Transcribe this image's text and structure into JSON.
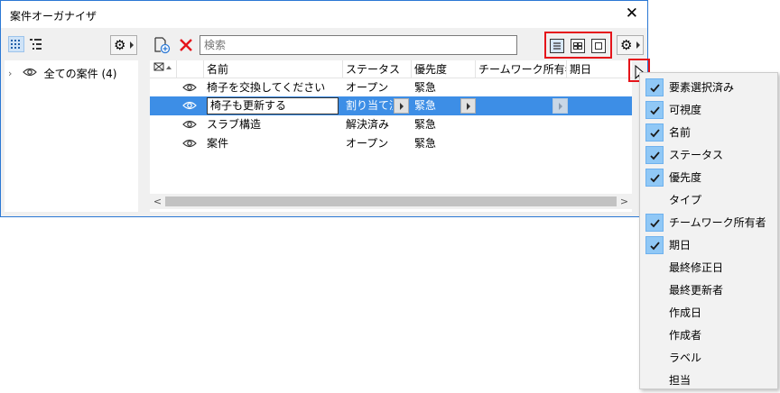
{
  "window": {
    "title": "案件オーガナイザ"
  },
  "tree": {
    "root_label": "全ての案件 (4)"
  },
  "search": {
    "placeholder": "検索"
  },
  "columns": [
    "名前",
    "ステータス",
    "優先度",
    "チームワーク所有者",
    "期日"
  ],
  "rows": [
    {
      "name": "椅子を交換してください",
      "status": "オープン",
      "priority": "緊急",
      "selected": false
    },
    {
      "name": "椅子も更新する",
      "status": "割り当て済",
      "priority": "緊急",
      "selected": true
    },
    {
      "name": "スラブ構造",
      "status": "解決済み",
      "priority": "緊急",
      "selected": false
    },
    {
      "name": "案件",
      "status": "オープン",
      "priority": "緊急",
      "selected": false
    }
  ],
  "column_menu": [
    {
      "label": "要素選択済み",
      "checked": true
    },
    {
      "label": "可視度",
      "checked": true
    },
    {
      "label": "名前",
      "checked": true
    },
    {
      "label": "ステータス",
      "checked": true
    },
    {
      "label": "優先度",
      "checked": true
    },
    {
      "label": "タイプ",
      "checked": false
    },
    {
      "label": "チームワーク所有者",
      "checked": true
    },
    {
      "label": "期日",
      "checked": true
    },
    {
      "label": "最終修正日",
      "checked": false
    },
    {
      "label": "最終更新者",
      "checked": false
    },
    {
      "label": "作成日",
      "checked": false
    },
    {
      "label": "作成者",
      "checked": false
    },
    {
      "label": "ラベル",
      "checked": false
    },
    {
      "label": "担当",
      "checked": false
    }
  ],
  "colors": {
    "selection": "#3d8ee6",
    "highlight": "#e5141a",
    "checkbox": "#90c8f6",
    "window_border": "#2b78d4"
  },
  "icons": [
    "close-icon",
    "tile-view-icon",
    "tree-view-icon",
    "gear-icon",
    "eye-icon",
    "new-issue-icon",
    "delete-icon",
    "list-view-icon",
    "grid-view-icon",
    "single-view-icon",
    "check-icon",
    "mouse-cursor-icon"
  ]
}
